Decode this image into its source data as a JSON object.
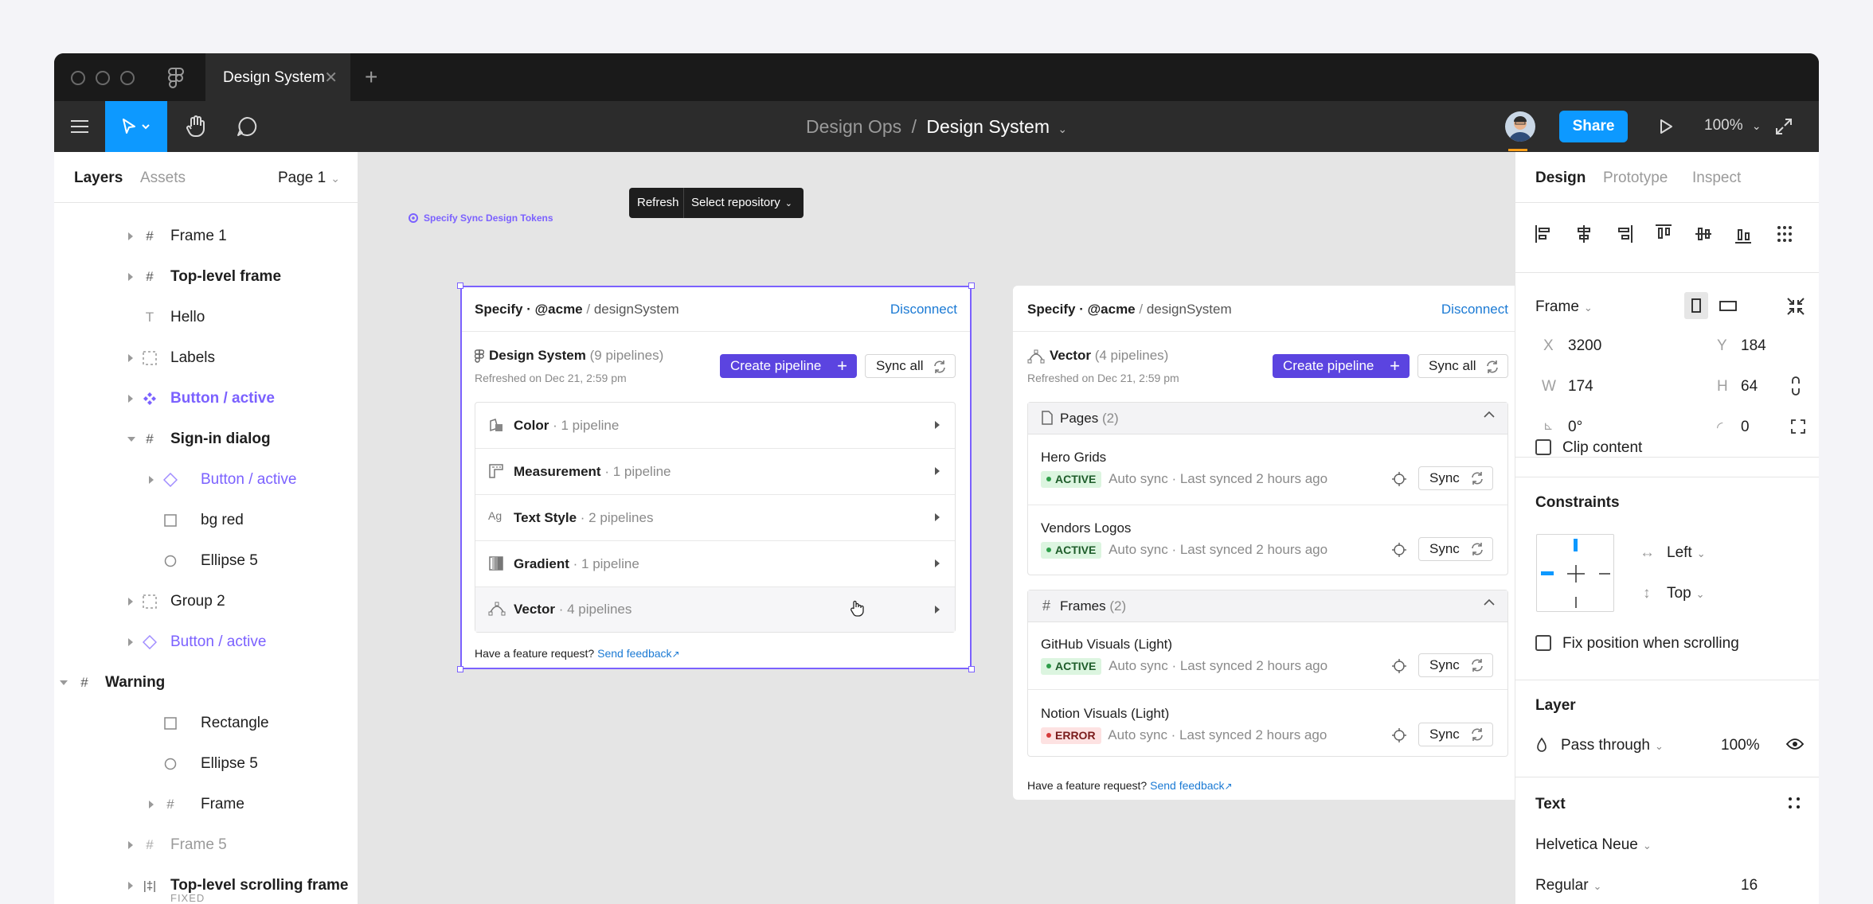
{
  "titlebar": {
    "tab_title": "Design System",
    "tab_close": "✕",
    "new_tab": "+"
  },
  "toolbar": {
    "breadcrumb_parent": "Design Ops",
    "breadcrumb_sep": "/",
    "breadcrumb_current": "Design System",
    "share_label": "Share",
    "zoom_label": "100%"
  },
  "left_panel": {
    "tabs": [
      "Layers",
      "Assets"
    ],
    "page_selector": "Page 1",
    "layers": [
      {
        "label": "Frame 1",
        "icon": "frame-icon"
      },
      {
        "label": "Top-level frame",
        "icon": "frame-icon"
      },
      {
        "label": "Hello",
        "icon": "text-icon"
      },
      {
        "label": "Labels",
        "icon": "group-icon"
      },
      {
        "label": "Button / active",
        "icon": "component-icon"
      },
      {
        "label": "Sign-in dialog",
        "icon": "frame-icon"
      },
      {
        "label": "Button / active",
        "icon": "instance-icon"
      },
      {
        "label": "bg red",
        "icon": "rectangle-icon"
      },
      {
        "label": "Ellipse 5",
        "icon": "ellipse-icon"
      },
      {
        "label": "Group 2",
        "icon": "group-icon"
      },
      {
        "label": "Button / active",
        "icon": "instance-icon"
      },
      {
        "label": "Warning",
        "icon": "frame-icon"
      },
      {
        "label": "Rectangle",
        "icon": "rectangle-icon"
      },
      {
        "label": "Ellipse 5",
        "icon": "ellipse-icon"
      },
      {
        "label": "Frame",
        "icon": "frame-icon"
      },
      {
        "label": "Frame 5",
        "icon": "frame-icon"
      },
      {
        "label": "Top-level scrolling frame",
        "icon": "scroll-frame-icon"
      },
      {
        "label": "FIXED",
        "icon": ""
      }
    ]
  },
  "canvas": {
    "frame_label": "Specify Sync Design Tokens",
    "floating_toolbar": {
      "refresh": "Refresh",
      "select_repo": "Select repository"
    },
    "card1": {
      "header_org": "Specify · @acme",
      "header_sep": "/",
      "header_repo": "designSystem",
      "disconnect": "Disconnect",
      "title": "Design System",
      "title_count": "(9 pipelines)",
      "refreshed": "Refreshed on Dec 21, 2:59 pm",
      "create_pipeline": "Create pipeline",
      "sync_all": "Sync all",
      "rows": [
        {
          "name": "Color",
          "count": "· 1 pipeline"
        },
        {
          "name": "Measurement",
          "count": "· 1 pipeline"
        },
        {
          "name": "Text Style",
          "count": "· 2 pipelines"
        },
        {
          "name": "Gradient",
          "count": "· 1 pipeline"
        },
        {
          "name": "Vector",
          "count": "· 4 pipelines"
        }
      ],
      "feedback_q": "Have a feature request?",
      "feedback_link": "Send feedback"
    },
    "card2": {
      "header_org": "Specify · @acme",
      "header_sep": "/",
      "header_repo": "designSystem",
      "disconnect": "Disconnect",
      "title": "Vector",
      "title_count": "(4 pipelines)",
      "refreshed": "Refreshed on Dec 21, 2:59 pm",
      "create_pipeline": "Create pipeline",
      "sync_all": "Sync all",
      "pages_label": "Pages",
      "pages_count": "(2)",
      "frames_label": "Frames",
      "frames_count": "(2)",
      "items": [
        {
          "name": "Hero Grids",
          "status": "ACTIVE",
          "meta": "Auto sync · Last synced 2 hours ago",
          "sync": "Sync"
        },
        {
          "name": "Vendors Logos",
          "status": "ACTIVE",
          "meta": "Auto sync · Last synced 2 hours ago",
          "sync": "Sync"
        },
        {
          "name": "GitHub Visuals (Light)",
          "status": "ACTIVE",
          "meta": "Auto sync · Last synced 2 hours ago",
          "sync": "Sync"
        },
        {
          "name": "Notion Visuals (Light)",
          "status": "ERROR",
          "meta": "Auto sync · Last synced 2 hours ago",
          "sync": "Sync"
        }
      ],
      "feedback_q": "Have a feature request?",
      "feedback_link": "Send feedback"
    }
  },
  "right_panel": {
    "tabs": [
      "Design",
      "Prototype",
      "Inspect"
    ],
    "frame_label": "Frame",
    "x_label": "X",
    "x_value": "3200",
    "y_label": "Y",
    "y_value": "184",
    "w_label": "W",
    "w_value": "174",
    "h_label": "H",
    "h_value": "64",
    "rotation": "0°",
    "radius": "0",
    "clip_content": "Clip content",
    "constraints_title": "Constraints",
    "constraint_h": "Left",
    "constraint_v": "Top",
    "fix_position": "Fix position when scrolling",
    "layer_title": "Layer",
    "blend_mode": "Pass through",
    "opacity": "100%",
    "text_title": "Text",
    "font_family": "Helvetica Neue",
    "font_weight": "Regular",
    "font_size": "16"
  },
  "colors": {
    "accent": "#0d99ff",
    "plugin_primary": "#5b44e0",
    "component": "#7b61ff",
    "active_badge": "#dcf5e0",
    "error_badge": "#fde2e2"
  }
}
